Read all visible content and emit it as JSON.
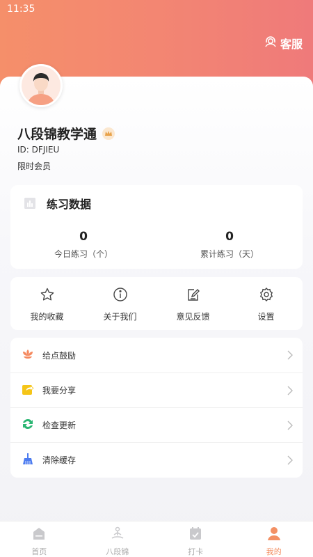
{
  "status_bar": {
    "time": "11:35"
  },
  "header": {
    "service_label": "客服"
  },
  "profile": {
    "name": "八段锦教学通",
    "id_text": "ID: DFJIEU",
    "membership": "限时会员"
  },
  "stats": {
    "title": "练习数据",
    "items": [
      {
        "value": "0",
        "label": "今日练习（个）"
      },
      {
        "value": "0",
        "label": "累计练习（天）"
      }
    ]
  },
  "shortcuts": [
    {
      "label": "我的收藏",
      "icon": "star-icon"
    },
    {
      "label": "关于我们",
      "icon": "info-icon"
    },
    {
      "label": "意见反馈",
      "icon": "feedback-icon"
    },
    {
      "label": "设置",
      "icon": "gear-icon"
    }
  ],
  "menu": [
    {
      "label": "给点鼓励",
      "icon": "lotus-icon",
      "color": "#f5895f"
    },
    {
      "label": "我要分享",
      "icon": "share-icon",
      "color": "#f5c518"
    },
    {
      "label": "检查更新",
      "icon": "refresh-icon",
      "color": "#2bb673"
    },
    {
      "label": "清除缓存",
      "icon": "broom-icon",
      "color": "#4d7cf0"
    }
  ],
  "tabbar": {
    "items": [
      {
        "label": "首页",
        "icon": "home-icon",
        "active": false
      },
      {
        "label": "八段锦",
        "icon": "meditation-icon",
        "active": false
      },
      {
        "label": "打卡",
        "icon": "calendar-check-icon",
        "active": false
      },
      {
        "label": "我的",
        "icon": "person-icon",
        "active": true
      }
    ]
  },
  "colors": {
    "accent": "#f39064",
    "header_start": "#f58f6a",
    "header_end": "#ef7a7a"
  }
}
